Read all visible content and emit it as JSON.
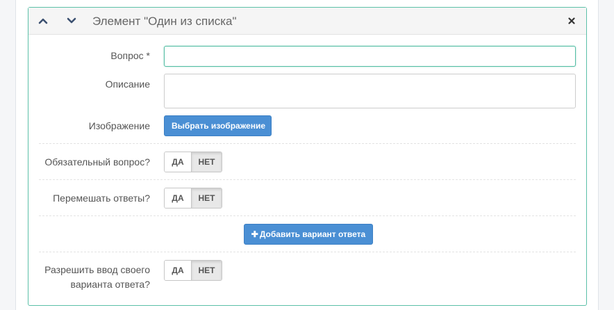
{
  "panel": {
    "title": "Элемент \"Один из списка\"",
    "accent_color": "#5bc0a8"
  },
  "form": {
    "question_label": "Вопрос *",
    "question_value": "",
    "description_label": "Описание",
    "description_value": "",
    "image_label": "Изображение",
    "image_button": "Выбрать изображение",
    "required_label": "Обязательный вопрос?",
    "required_yes": "ДА",
    "required_no": "НЕТ",
    "required_selected": "НЕТ",
    "shuffle_label": "Перемешать ответы?",
    "shuffle_yes": "ДА",
    "shuffle_no": "НЕТ",
    "shuffle_selected": "НЕТ",
    "add_option_button": "Добавить вариант ответа",
    "custom_label_line1": "Разрешить ввод своего",
    "custom_label_line2": "варианта ответа?",
    "custom_yes": "ДА",
    "custom_no": "НЕТ",
    "custom_selected": "НЕТ"
  },
  "icons": {
    "collapse": "chevron-up-icon",
    "expand": "chevron-down-icon",
    "close": "close-icon",
    "add": "plus-icon"
  },
  "colors": {
    "primary_button": "#4a8fd4",
    "focus_border": "#53bda4"
  }
}
